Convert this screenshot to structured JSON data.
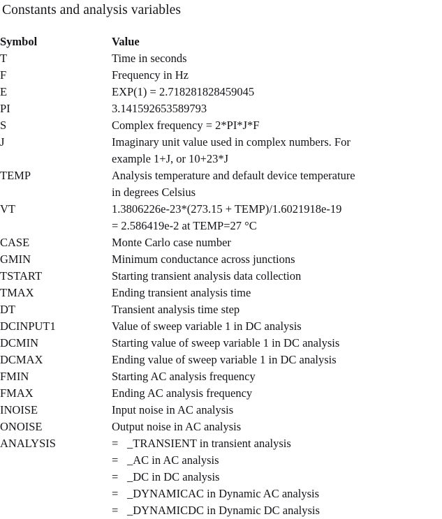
{
  "document": {
    "title": "Constants and analysis variables"
  },
  "table": {
    "headers": {
      "symbol": "Symbol",
      "value": "Value"
    },
    "rows": [
      {
        "symbol": "T",
        "lines": [
          "Time in seconds"
        ]
      },
      {
        "symbol": "F",
        "lines": [
          "Frequency in Hz"
        ]
      },
      {
        "symbol": "E",
        "lines": [
          "EXP(1) = 2.718281828459045"
        ]
      },
      {
        "symbol": "PI",
        "lines": [
          "3.141592653589793"
        ]
      },
      {
        "symbol": "S",
        "lines": [
          "Complex frequency = 2*PI*J*F"
        ]
      },
      {
        "symbol": "J",
        "lines": [
          "Imaginary unit value used in complex numbers. For",
          "example 1+J, or 10+23*J"
        ]
      },
      {
        "symbol": "TEMP",
        "lines": [
          "Analysis temperature and default device temperature",
          "in degrees Celsius"
        ]
      },
      {
        "symbol": "VT",
        "lines": [
          "1.3806226e-23*(273.15 + TEMP)/1.6021918e-19",
          " = 2.586419e-2 at TEMP=27 °C"
        ]
      },
      {
        "symbol": "CASE",
        "lines": [
          "Monte Carlo case number"
        ]
      },
      {
        "symbol": "GMIN",
        "lines": [
          "Minimum conductance across junctions"
        ]
      },
      {
        "symbol": "TSTART",
        "lines": [
          "Starting transient analysis data collection"
        ]
      },
      {
        "symbol": "TMAX",
        "lines": [
          "Ending transient analysis time"
        ]
      },
      {
        "symbol": "DT",
        "lines": [
          "Transient analysis time step"
        ]
      },
      {
        "symbol": "DCINPUT1",
        "lines": [
          "Value of sweep variable 1 in DC analysis"
        ]
      },
      {
        "symbol": "DCMIN",
        "lines": [
          "Starting value of sweep variable 1 in DC analysis"
        ]
      },
      {
        "symbol": "DCMAX",
        "lines": [
          "Ending value of sweep variable 1 in DC analysis"
        ]
      },
      {
        "symbol": "FMIN",
        "lines": [
          "Starting AC analysis frequency"
        ]
      },
      {
        "symbol": "FMAX",
        "lines": [
          "Ending AC analysis frequency"
        ]
      },
      {
        "symbol": "INOISE",
        "lines": [
          "Input noise in AC analysis"
        ]
      },
      {
        "symbol": "ONOISE",
        "lines": [
          "Output noise in AC analysis"
        ]
      },
      {
        "symbol": "ANALYSIS",
        "eq_lines": [
          {
            "sign": "=",
            "text": "_TRANSIENT in transient analysis"
          },
          {
            "sign": "=",
            "text": "_AC in AC analysis"
          },
          {
            "sign": "=",
            "text": "_DC in DC analysis"
          },
          {
            "sign": "=",
            "text": "_DYNAMICAC in Dynamic AC analysis"
          },
          {
            "sign": "=",
            "text": "_DYNAMICDC in Dynamic DC analysis"
          }
        ]
      }
    ]
  },
  "style": {
    "background": "#ffffff",
    "text_color": "#141418"
  }
}
